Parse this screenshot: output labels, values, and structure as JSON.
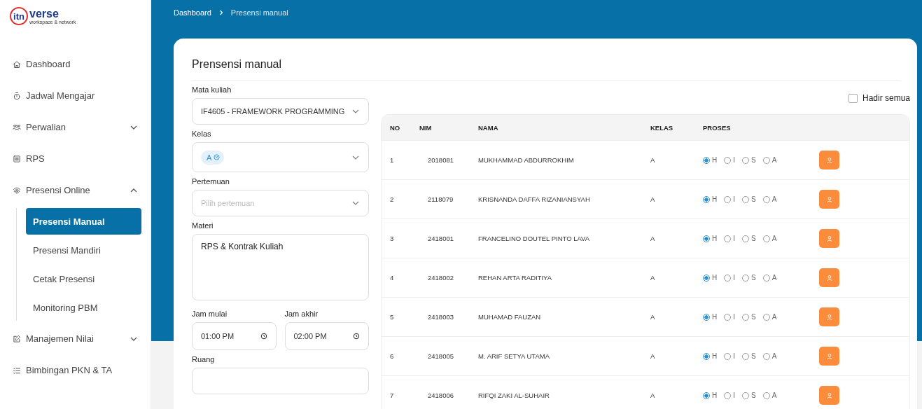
{
  "logo": {
    "mark": "itn",
    "name": "verse",
    "tagline": "workspace & network"
  },
  "sidebar": {
    "items": [
      {
        "label": "Dashboard",
        "kind": "item"
      },
      {
        "label": "Jadwal Mengajar",
        "kind": "item"
      },
      {
        "label": "Perwalian",
        "kind": "group",
        "expanded": false
      },
      {
        "label": "RPS",
        "kind": "item"
      },
      {
        "label": "Presensi Online",
        "kind": "group",
        "expanded": true,
        "children": [
          {
            "label": "Presensi Manual",
            "selected": true
          },
          {
            "label": "Presensi Mandiri",
            "selected": false
          },
          {
            "label": "Cetak Presensi",
            "selected": false
          },
          {
            "label": "Monitoring PBM",
            "selected": false
          }
        ]
      },
      {
        "label": "Manajemen Nilai",
        "kind": "group",
        "expanded": false
      },
      {
        "label": "Bimbingan PKN & TA",
        "kind": "item"
      }
    ]
  },
  "breadcrumb": [
    "Dashboard",
    "Presensi manual"
  ],
  "card": {
    "title": "Prensensi manual",
    "form": {
      "course": {
        "label": "Mata kuliah",
        "value": "IF4605 - FRAMEWORK PROGRAMMING"
      },
      "class": {
        "label": "Kelas",
        "tags": [
          "A"
        ]
      },
      "meeting": {
        "label": "Pertemuan",
        "placeholder": "Pilih pertemuan"
      },
      "material": {
        "label": "Materi",
        "value": "RPS & Kontrak Kuliah"
      },
      "start": {
        "label": "Jam mulai",
        "value": "01:00 PM"
      },
      "end": {
        "label": "Jam akhir",
        "value": "02:00 PM"
      },
      "room": {
        "label": "Ruang"
      }
    },
    "all_present": {
      "label": "Hadir semua",
      "checked": false
    },
    "table": {
      "columns": [
        "NO",
        "NIM",
        "NAMA",
        "KELAS",
        "PROSES"
      ],
      "rows": [
        {
          "no": "1",
          "nim": "2018081",
          "name": "MUKHAMMAD ABDURROKHIM",
          "class": "A",
          "status": [
            {
              "label": "H",
              "selected": true
            },
            {
              "label": "I",
              "selected": false
            },
            {
              "label": "S",
              "selected": false
            },
            {
              "label": "A",
              "selected": false
            }
          ]
        },
        {
          "no": "2",
          "nim": "2118079",
          "name": "KRISNANDA DAFFA RIZANIANSYAH",
          "class": "A",
          "status": [
            {
              "label": "H",
              "selected": true
            },
            {
              "label": "I",
              "selected": false
            },
            {
              "label": "S",
              "selected": false
            },
            {
              "label": "A",
              "selected": false
            }
          ]
        },
        {
          "no": "3",
          "nim": "2418001",
          "name": "FRANCELINO DOUTEL PINTO LAVA",
          "class": "A",
          "status": [
            {
              "label": "H",
              "selected": true
            },
            {
              "label": "I",
              "selected": false
            },
            {
              "label": "S",
              "selected": false
            },
            {
              "label": "A",
              "selected": false
            }
          ]
        },
        {
          "no": "4",
          "nim": "2418002",
          "name": "REHAN ARTA RADITIYA",
          "class": "A",
          "status": [
            {
              "label": "H",
              "selected": true
            },
            {
              "label": "I",
              "selected": false
            },
            {
              "label": "S",
              "selected": false
            },
            {
              "label": "A",
              "selected": false
            }
          ]
        },
        {
          "no": "5",
          "nim": "2418003",
          "name": "MUHAMAD FAUZAN",
          "class": "A",
          "status": [
            {
              "label": "H",
              "selected": true
            },
            {
              "label": "I",
              "selected": false
            },
            {
              "label": "S",
              "selected": false
            },
            {
              "label": "A",
              "selected": false
            }
          ]
        },
        {
          "no": "6",
          "nim": "2418005",
          "name": "M. ARIF SETYA UTAMA",
          "class": "A",
          "status": [
            {
              "label": "H",
              "selected": true
            },
            {
              "label": "I",
              "selected": false
            },
            {
              "label": "S",
              "selected": false
            },
            {
              "label": "A",
              "selected": false
            }
          ]
        },
        {
          "no": "7",
          "nim": "2418006",
          "name": "RIFQI ZAKI AL-SUHAIR",
          "class": "A",
          "status": [
            {
              "label": "H",
              "selected": true
            },
            {
              "label": "I",
              "selected": false
            },
            {
              "label": "S",
              "selected": false
            },
            {
              "label": "A",
              "selected": false
            }
          ]
        }
      ]
    }
  }
}
